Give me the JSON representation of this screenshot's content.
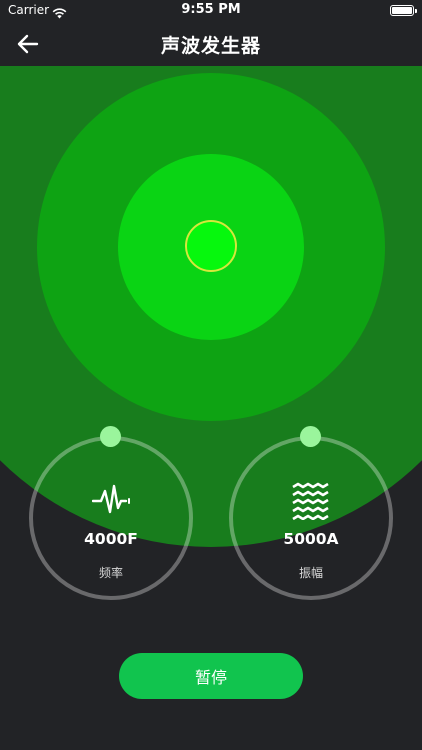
{
  "status_bar": {
    "carrier": "Carrier",
    "time": "9:55 PM"
  },
  "nav": {
    "title": "声波发生器",
    "back_icon": "arrow-left-icon"
  },
  "sound_wave": {
    "colors": {
      "background": "#222326",
      "ring_outer": "#187d1d",
      "ring_middle": "#0ea313",
      "ring_inner": "#0ad414",
      "ring_core": "#06f80d",
      "core_border": "#d6e83c"
    }
  },
  "controls": {
    "frequency": {
      "value": "4000F",
      "label": "频率",
      "icon": "waveform-pulse-icon"
    },
    "amplitude": {
      "value": "5000A",
      "label": "振幅",
      "icon": "zigzag-waves-icon"
    },
    "knob_handle_color": "#9af59c"
  },
  "actions": {
    "pause_label": "暂停",
    "button_color": "#11c44e"
  }
}
